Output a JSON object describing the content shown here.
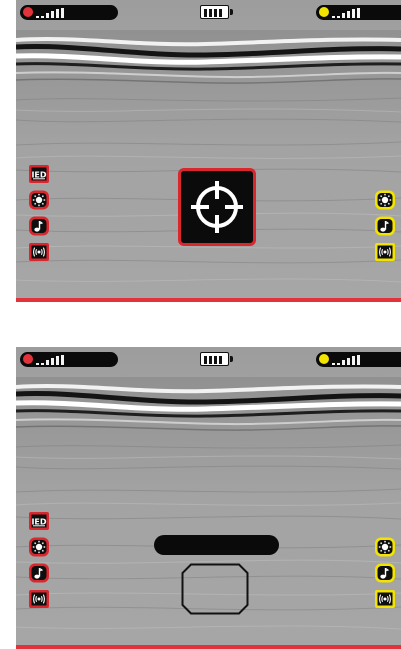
{
  "screens": [
    {
      "id": "top",
      "status": {
        "left_signal_color": "#e2323a",
        "right_signal_color": "#f2e300",
        "left_signal_level": 4,
        "right_signal_level": 4,
        "battery_level": 4
      },
      "left_icons": [
        {
          "name": "ied-icon",
          "text": "IED",
          "color": "#d9272e"
        },
        {
          "name": "brightness-icon",
          "color": "#d9272e"
        },
        {
          "name": "music-note-icon",
          "color": "#d9272e"
        },
        {
          "name": "vibration-icon",
          "color": "#d9272e"
        }
      ],
      "right_icons": [
        {
          "name": "brightness-icon",
          "color": "#f2e300"
        },
        {
          "name": "music-note-icon",
          "color": "#f2e300"
        },
        {
          "name": "vibration-icon",
          "color": "#f2e300"
        }
      ],
      "center_icon": "crosshair-icon"
    },
    {
      "id": "bottom",
      "status": {
        "left_signal_color": "#e2323a",
        "right_signal_color": "#f2e300",
        "left_signal_level": 4,
        "right_signal_level": 4,
        "battery_level": 4
      },
      "left_icons": [
        {
          "name": "ied-icon",
          "text": "IED",
          "color": "#d9272e"
        },
        {
          "name": "brightness-icon",
          "color": "#d9272e"
        },
        {
          "name": "music-note-icon",
          "color": "#d9272e"
        },
        {
          "name": "vibration-icon",
          "color": "#d9272e"
        }
      ],
      "right_icons": [
        {
          "name": "brightness-icon",
          "color": "#f2e300"
        },
        {
          "name": "music-note-icon",
          "color": "#f2e300"
        },
        {
          "name": "vibration-icon",
          "color": "#f2e300"
        }
      ],
      "center_icon": "empty-target-outline"
    }
  ],
  "colors": {
    "accent_red": "#d9272e",
    "accent_yellow": "#f2e300",
    "background_gray": "#9e9e9e"
  }
}
